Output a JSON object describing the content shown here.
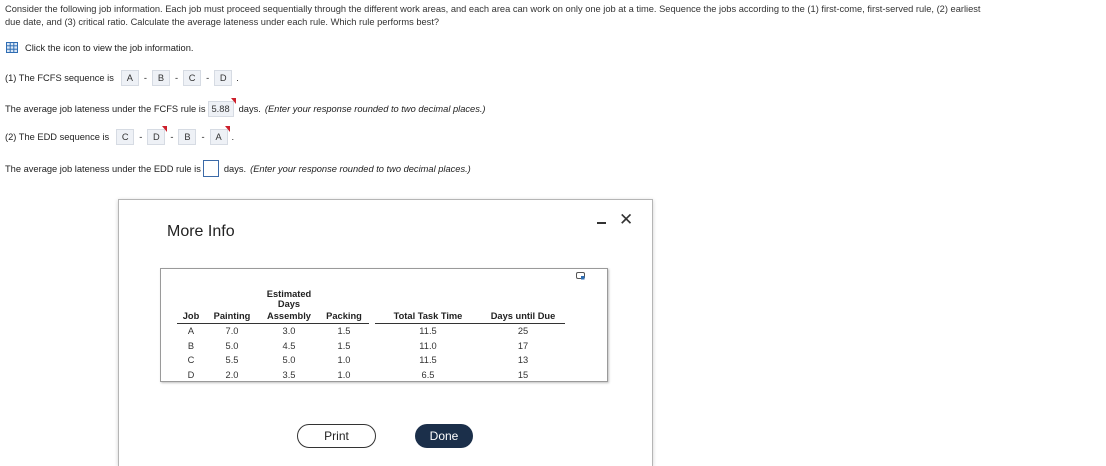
{
  "question": {
    "line1": "Consider the following job information. Each job must proceed sequentially through the different work areas, and each area can work on only one job at a time. Sequence the jobs according to the (1) first-come, first-served rule, (2) earliest",
    "line2": "due date, and (3) critical ratio. Calculate the average lateness under each rule. Which rule performs best?"
  },
  "info_link": {
    "label": "Click the icon to view the job information.",
    "icon": "table-grid-icon"
  },
  "part1": {
    "prefix": "(1) The FCFS sequence is",
    "sequence": [
      "A",
      "B",
      "C",
      "D"
    ],
    "end": "."
  },
  "part1_avg": {
    "prefix": "The average job lateness under the FCFS rule is",
    "value": "5.88",
    "suffix_plain": "days.",
    "suffix_italic": "(Enter your response rounded to two decimal places.)"
  },
  "part2": {
    "prefix": "(2) The EDD sequence is",
    "sequence": [
      "C",
      "D",
      "B",
      "A"
    ],
    "end": "."
  },
  "part2_avg": {
    "prefix": "The average job lateness under the EDD rule is",
    "value": "",
    "suffix_plain": "days.",
    "suffix_italic": "(Enter your response rounded to two decimal places.)"
  },
  "modal": {
    "title": "More Info",
    "group_header": "Estimated Days",
    "columns": [
      "Job",
      "Painting",
      "Assembly",
      "Packing",
      "Total Task Time",
      "Days until Due"
    ],
    "rows": [
      [
        "A",
        "7.0",
        "3.0",
        "1.5",
        "11.5",
        "25"
      ],
      [
        "B",
        "5.0",
        "4.5",
        "1.5",
        "11.0",
        "17"
      ],
      [
        "C",
        "5.5",
        "5.0",
        "1.0",
        "11.5",
        "13"
      ],
      [
        "D",
        "2.0",
        "3.5",
        "1.0",
        "6.5",
        "15"
      ]
    ],
    "print_label": "Print",
    "done_label": "Done"
  }
}
